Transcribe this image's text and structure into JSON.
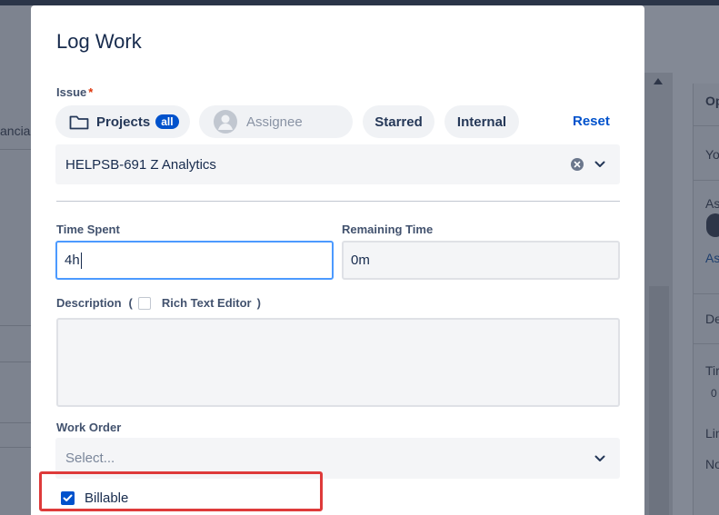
{
  "background": {
    "left_fragment": "ancia",
    "right_fragments": [
      "Op",
      "Yo",
      "As",
      "As",
      "De",
      "Tir",
      "0",
      "Lin",
      "No"
    ]
  },
  "modal": {
    "title": "Log Work",
    "issue": {
      "label": "Issue",
      "required_mark": "*",
      "filters": {
        "projects_label": "Projects",
        "projects_badge": "all",
        "assignee_placeholder": "Assignee",
        "starred_label": "Starred",
        "internal_label": "Internal",
        "reset_label": "Reset"
      },
      "selected_value": "HELPSB-691 Z Analytics"
    },
    "time_spent": {
      "label": "Time Spent",
      "value": "4h"
    },
    "remaining_time": {
      "label": "Remaining Time",
      "value": "0m"
    },
    "description": {
      "label": "Description",
      "open_paren": "(",
      "rich_text_label": "Rich Text Editor",
      "close_paren": ")",
      "value": ""
    },
    "work_order": {
      "label": "Work Order",
      "placeholder": "Select..."
    },
    "billable": {
      "label": "Billable",
      "checked": true
    }
  },
  "colors": {
    "accent": "#0052cc",
    "highlight": "#de3a3a",
    "focus": "#4c9aff"
  },
  "icons": [
    "folder-icon",
    "avatar-icon",
    "clear-icon",
    "chevron-down-icon",
    "check-icon"
  ]
}
